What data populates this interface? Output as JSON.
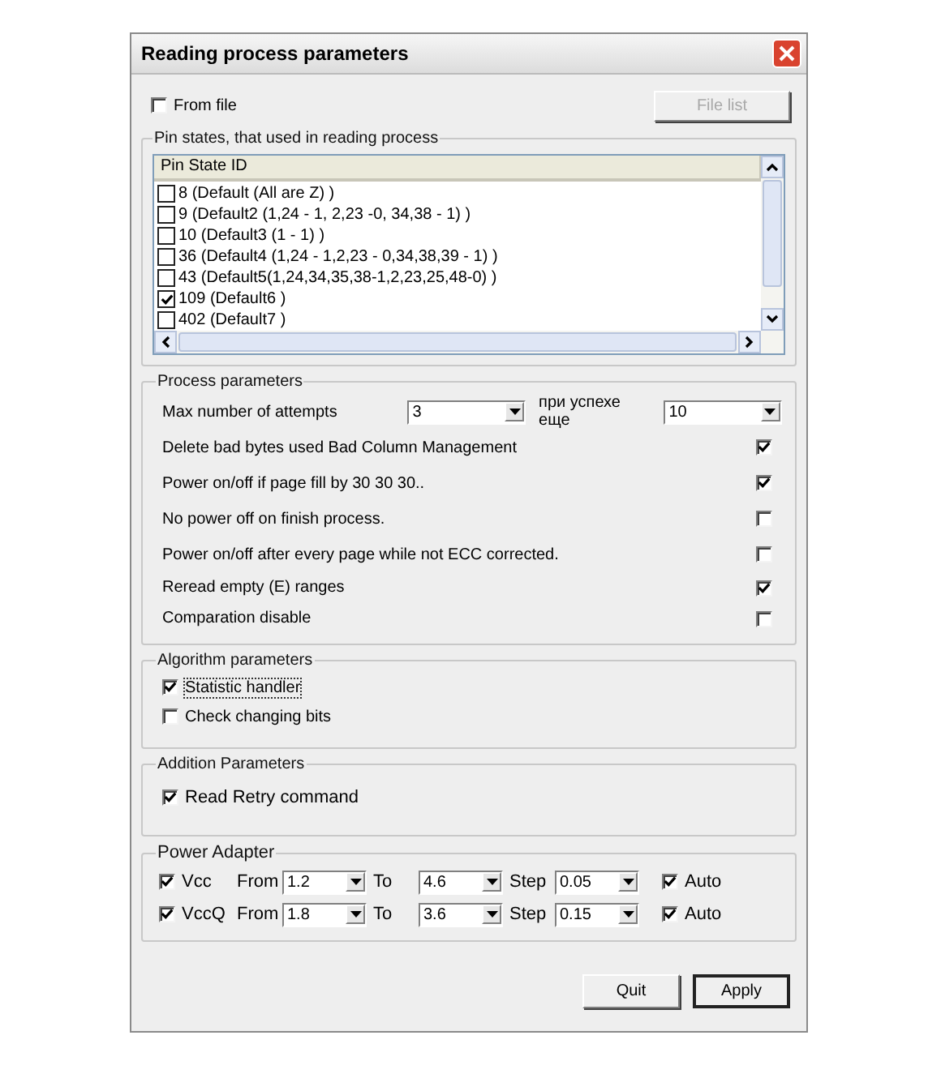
{
  "window": {
    "title": "Reading process parameters"
  },
  "from_file": {
    "label": "From file",
    "checked": false
  },
  "file_list_button": {
    "label": "File list",
    "disabled": true
  },
  "pin_states": {
    "title": "Pin states, that used in reading process",
    "column": "Pin State ID",
    "items": [
      {
        "label": "8 (Default (All are Z) )",
        "checked": false
      },
      {
        "label": "9 (Default2 (1,24 - 1, 2,23 -0, 34,38 - 1) )",
        "checked": false
      },
      {
        "label": "10 (Default3 (1 - 1) )",
        "checked": false
      },
      {
        "label": "36 (Default4 (1,24 - 1,2,23 - 0,34,38,39 - 1) )",
        "checked": false
      },
      {
        "label": "43 (Default5(1,24,34,35,38-1,2,23,25,48-0) )",
        "checked": false
      },
      {
        "label": "109 (Default6 )",
        "checked": true
      },
      {
        "label": "402 (Default7 )",
        "checked": false
      }
    ]
  },
  "process_parameters": {
    "title": "Process parameters",
    "max_attempts": {
      "label": "Max number of attempts",
      "value": "3"
    },
    "on_success": {
      "label": "при успехе еще",
      "value": "10"
    },
    "options": [
      {
        "label": "Delete bad bytes used Bad Column Management",
        "checked": true
      },
      {
        "label": "Power on/off if page fill by 30 30 30..",
        "checked": true
      },
      {
        "label": "No power off on finish process.",
        "checked": false
      },
      {
        "label": "Power on/off after every page while not ECC corrected.",
        "checked": false
      },
      {
        "label": "Reread empty (E) ranges",
        "checked": true
      },
      {
        "label": "Comparation disable",
        "checked": false
      }
    ]
  },
  "algorithm_parameters": {
    "title": "Algorithm parameters",
    "options": [
      {
        "label": "Statistic handler",
        "checked": true,
        "focused": true
      },
      {
        "label": "Check changing bits",
        "checked": false,
        "focused": false
      }
    ]
  },
  "addition_parameters": {
    "title": "Addition Parameters",
    "options": [
      {
        "label": "Read Retry command",
        "checked": true
      }
    ]
  },
  "power_adapter": {
    "title": "Power Adapter",
    "rows": [
      {
        "name": "Vcc",
        "checked": true,
        "from_label": "From",
        "from": "1.2",
        "to_label": "To",
        "to": "4.6",
        "step_label": "Step",
        "step": "0.05",
        "auto_label": "Auto",
        "auto": true
      },
      {
        "name": "VccQ",
        "checked": true,
        "from_label": "From",
        "from": "1.8",
        "to_label": "To",
        "to": "3.6",
        "step_label": "Step",
        "step": "0.15",
        "auto_label": "Auto",
        "auto": true
      }
    ]
  },
  "buttons": [
    {
      "label": "Quit",
      "default": false
    },
    {
      "label": "Apply",
      "default": true
    }
  ]
}
